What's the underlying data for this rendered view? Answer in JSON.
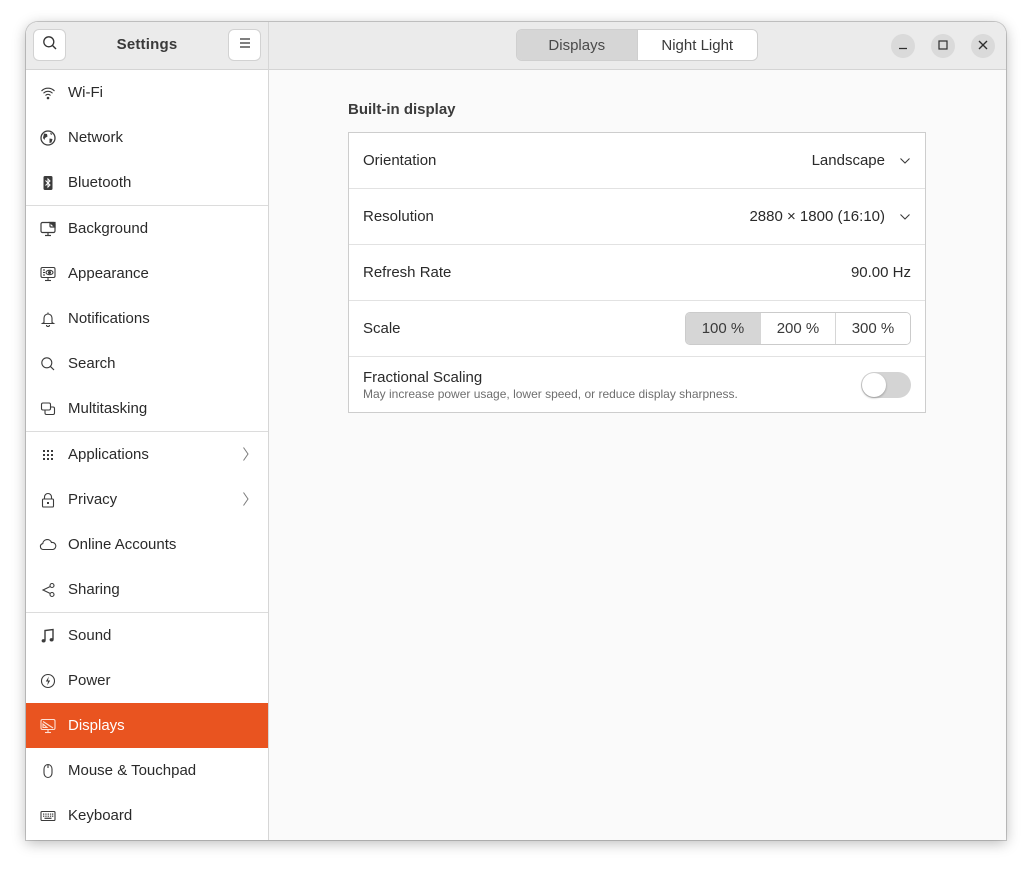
{
  "app": {
    "title": "Settings"
  },
  "header": {
    "search_icon": "search-icon",
    "menu_icon": "hamburger-menu-icon",
    "tabs": [
      {
        "label": "Displays",
        "active": true
      },
      {
        "label": "Night Light",
        "active": false
      }
    ],
    "window_controls": [
      "minimize",
      "maximize",
      "close"
    ]
  },
  "sidebar": {
    "items": [
      {
        "label": "Wi-Fi",
        "icon": "wifi-icon"
      },
      {
        "label": "Network",
        "icon": "globe-icon"
      },
      {
        "label": "Bluetooth",
        "icon": "bluetooth-icon"
      },
      {
        "label": "Background",
        "icon": "background-icon"
      },
      {
        "label": "Appearance",
        "icon": "appearance-icon"
      },
      {
        "label": "Notifications",
        "icon": "bell-icon"
      },
      {
        "label": "Search",
        "icon": "search-icon"
      },
      {
        "label": "Multitasking",
        "icon": "multitasking-icon"
      },
      {
        "label": "Applications",
        "icon": "apps-grid-icon",
        "has_submenu": true
      },
      {
        "label": "Privacy",
        "icon": "lock-icon",
        "has_submenu": true
      },
      {
        "label": "Online Accounts",
        "icon": "cloud-icon"
      },
      {
        "label": "Sharing",
        "icon": "share-icon"
      },
      {
        "label": "Sound",
        "icon": "music-note-icon"
      },
      {
        "label": "Power",
        "icon": "power-icon"
      },
      {
        "label": "Displays",
        "icon": "display-icon",
        "active": true
      },
      {
        "label": "Mouse & Touchpad",
        "icon": "mouse-icon"
      },
      {
        "label": "Keyboard",
        "icon": "keyboard-icon"
      }
    ]
  },
  "main": {
    "section_title": "Built-in display",
    "orientation": {
      "label": "Orientation",
      "value": "Landscape"
    },
    "resolution": {
      "label": "Resolution",
      "value": "2880 × 1800 (16:10)"
    },
    "refresh_rate": {
      "label": "Refresh Rate",
      "value": "90.00 Hz"
    },
    "scale": {
      "label": "Scale",
      "options": [
        "100 %",
        "200 %",
        "300 %"
      ],
      "selected": "100 %"
    },
    "fractional_scaling": {
      "label": "Fractional Scaling",
      "description": "May increase power usage, lower speed, or reduce display sharpness.",
      "enabled": false
    }
  },
  "colors": {
    "accent": "#e95420",
    "sidebar_bg": "#ffffff",
    "header_bg": "#ebebeb",
    "content_bg": "#fafafa"
  }
}
